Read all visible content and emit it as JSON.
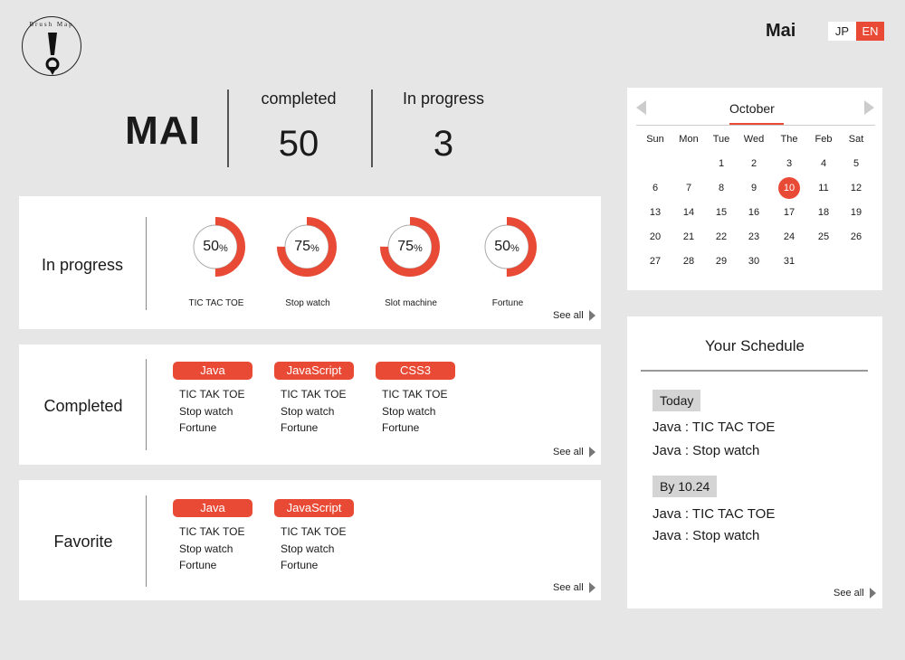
{
  "header": {
    "logo_text": "Brush Map",
    "user_name": "Mai",
    "lang": [
      "JP",
      "EN"
    ]
  },
  "summary": {
    "name": "MAI",
    "completed_label": "completed",
    "completed_value": "50",
    "in_progress_label": "In progress",
    "in_progress_value": "3"
  },
  "in_progress": {
    "title": "In progress",
    "items": [
      {
        "label": "TIC TAC TOE",
        "percent": 50
      },
      {
        "label": "Stop watch",
        "percent": 75
      },
      {
        "label": "Slot machine",
        "percent": 75
      },
      {
        "label": "Fortune",
        "percent": 50
      }
    ],
    "see_all": "See all",
    "accent": "#e84a35"
  },
  "completed": {
    "title": "Completed",
    "groups": [
      {
        "tag": "Java",
        "items": [
          "TIC TAK TOE",
          "Stop watch",
          "Fortune"
        ]
      },
      {
        "tag": "JavaScript",
        "items": [
          "TIC TAK TOE",
          "Stop watch",
          "Fortune"
        ]
      },
      {
        "tag": "CSS3",
        "items": [
          "TIC TAK TOE",
          "Stop watch",
          "Fortune"
        ]
      }
    ],
    "see_all": "See all"
  },
  "favorite": {
    "title": "Favorite",
    "groups": [
      {
        "tag": "Java",
        "items": [
          "TIC TAK TOE",
          "Stop watch",
          "Fortune"
        ]
      },
      {
        "tag": "JavaScript",
        "items": [
          "TIC TAK TOE",
          "Stop watch",
          "Fortune"
        ]
      }
    ],
    "see_all": "See all"
  },
  "calendar": {
    "month": "October",
    "weekdays": [
      "Sun",
      "Mon",
      "Tue",
      "Wed",
      "The",
      "Feb",
      "Sat"
    ],
    "weeks": [
      [
        "",
        "",
        "1",
        "2",
        "3",
        "4",
        "5"
      ],
      [
        "6",
        "7",
        "8",
        "9",
        "10",
        "11",
        "12"
      ],
      [
        "13",
        "14",
        "15",
        "16",
        "17",
        "18",
        "19"
      ],
      [
        "20",
        "21",
        "22",
        "23",
        "24",
        "25",
        "26"
      ],
      [
        "27",
        "28",
        "29",
        "30",
        "31",
        "",
        ""
      ]
    ],
    "selected": "10"
  },
  "schedule": {
    "title": "Your Schedule",
    "sections": [
      {
        "badge": "Today",
        "items": [
          "Java : TIC TAC TOE",
          "Java : Stop watch"
        ]
      },
      {
        "badge": "By 10.24",
        "items": [
          "Java : TIC TAC TOE",
          "Java : Stop watch"
        ]
      }
    ],
    "see_all": "See all"
  }
}
